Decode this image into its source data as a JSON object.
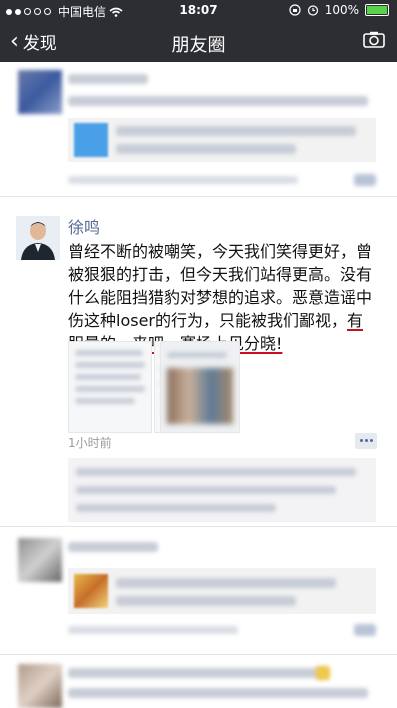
{
  "status_bar": {
    "carrier": "中国电信",
    "time": "18:07",
    "battery": "100%"
  },
  "nav": {
    "back_label": "发现",
    "title": "朋友圈"
  },
  "post": {
    "author": "徐鸣",
    "text_main": "曾经不断的被嘲笑，今天我们笑得更好，曾被狠狠的打击，但今天我们站得更高。没有什么能阻挡猎豹对梦想的追求。恶意造谣中伤这种loser的行为，只能被我们鄙视，",
    "text_highlight": "有胆量的，来吧，赛场上见分晓!",
    "timestamp": "1小时前"
  }
}
